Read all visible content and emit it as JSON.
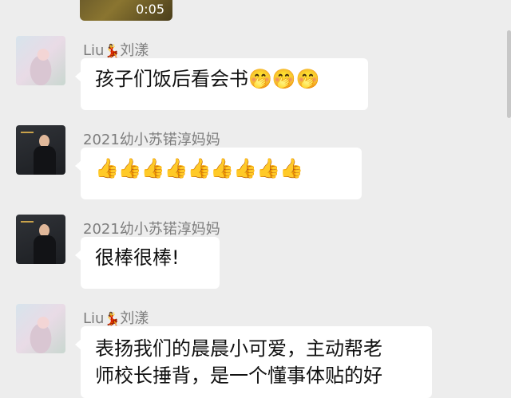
{
  "video": {
    "duration": "0:05"
  },
  "messages": [
    {
      "sender_name": "Liu",
      "sender_emoji": "💃",
      "sender_suffix": "刘漾",
      "text": "孩子们饭后看会书",
      "emojis": "🤭🤭🤭"
    },
    {
      "sender_name": "2021幼小苏锘淳妈妈",
      "text": "",
      "emojis": "👍👍👍👍👍👍👍👍👍"
    },
    {
      "sender_name": "2021幼小苏锘淳妈妈",
      "text": "很棒很棒!",
      "emojis": ""
    },
    {
      "sender_name": "Liu",
      "sender_emoji": "💃",
      "sender_suffix": "刘漾",
      "line1": "表扬我们的晨晨小可爱，主动帮老",
      "line2": "师校长捶背，是一个懂事体贴的好"
    }
  ]
}
